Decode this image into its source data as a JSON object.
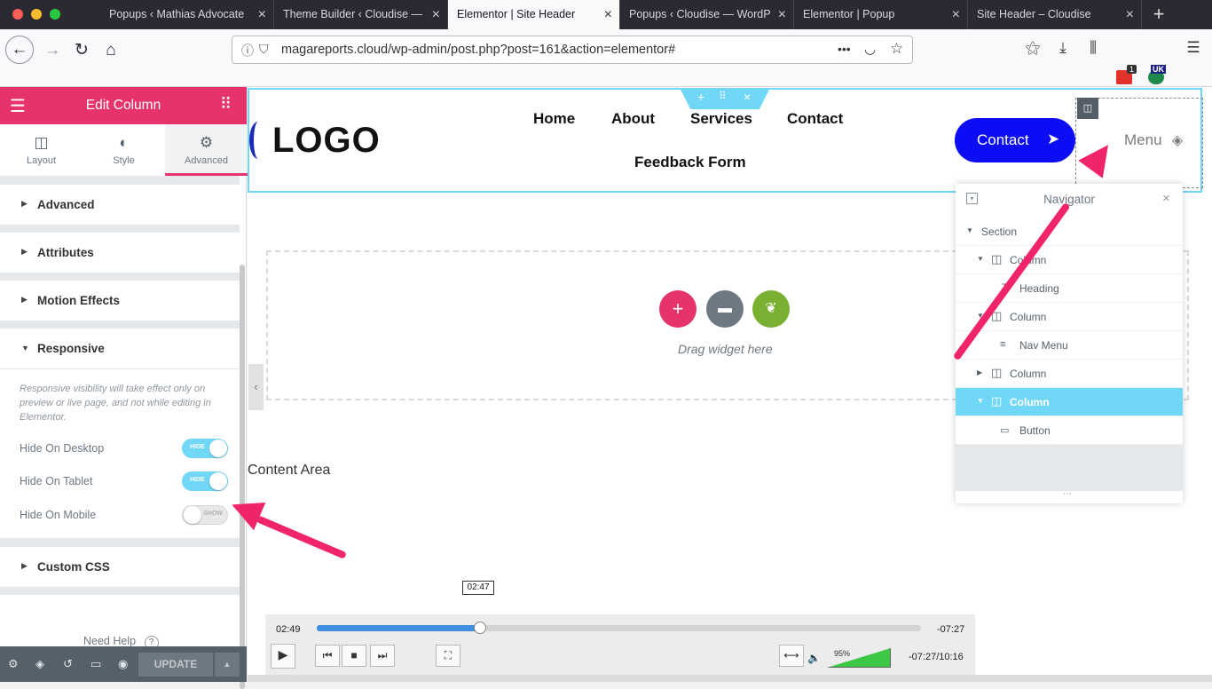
{
  "browser": {
    "tabs": [
      {
        "label": "Popups ‹ Mathias Advocate",
        "active": false
      },
      {
        "label": "Theme Builder ‹ Cloudise —",
        "active": false
      },
      {
        "label": "Elementor | Site Header",
        "active": true
      },
      {
        "label": "Popups ‹ Cloudise — WordP",
        "active": false
      },
      {
        "label": "Elementor | Popup",
        "active": false
      },
      {
        "label": "Site Header – Cloudise",
        "active": false
      }
    ],
    "url": "magareports.cloud/wp-admin/post.php?post=161&action=elementor#",
    "url_dots": "•••",
    "pocket_badge": "1",
    "uk_badge": "UK"
  },
  "panel": {
    "title": "Edit Column",
    "tabs": [
      {
        "label": "Layout",
        "icon": "columns-icon"
      },
      {
        "label": "Style",
        "icon": "contrast-icon"
      },
      {
        "label": "Advanced",
        "icon": "gear-icon"
      }
    ],
    "sections": {
      "advanced": "Advanced",
      "attributes": "Attributes",
      "motion": "Motion Effects",
      "responsive": "Responsive",
      "custom_css": "Custom CSS"
    },
    "responsive_note": "Responsive visibility will take effect only on preview or live page, and not while editing in Elementor.",
    "toggles": [
      {
        "label": "Hide On Desktop",
        "state": "HIDE",
        "on": true
      },
      {
        "label": "Hide On Tablet",
        "state": "HIDE",
        "on": true
      },
      {
        "label": "Hide On Mobile",
        "state": "SHOW",
        "on": false
      }
    ],
    "need_help": "Need Help",
    "update": "UPDATE"
  },
  "preview": {
    "logo": "LOGO",
    "menu": [
      "Home",
      "About",
      "Services",
      "Contact",
      "Feedback Form"
    ],
    "contact_button": "Contact",
    "menu_toggle": "Menu",
    "drag_text": "Drag widget here",
    "content_area": "Content Area"
  },
  "navigator": {
    "title": "Navigator",
    "items": [
      {
        "label": "Section",
        "selected": false
      },
      {
        "label": "Column",
        "selected": false
      },
      {
        "label": "Heading",
        "selected": false
      },
      {
        "label": "Column",
        "selected": false
      },
      {
        "label": "Nav Menu",
        "selected": false
      },
      {
        "label": "Column",
        "selected": false
      },
      {
        "label": "Column",
        "selected": true
      },
      {
        "label": "Button",
        "selected": false
      }
    ]
  },
  "video": {
    "tooltip": "02:47",
    "current": "02:49",
    "remaining": "-07:27",
    "status": "-07:27/10:16",
    "volume": "95%",
    "progress": 0.27
  },
  "colors": {
    "elementor_pink": "#e6336c",
    "accent_blue": "#71d7f7",
    "contact_blue": "#0c0cf5",
    "arrow_red": "#f0246b"
  }
}
